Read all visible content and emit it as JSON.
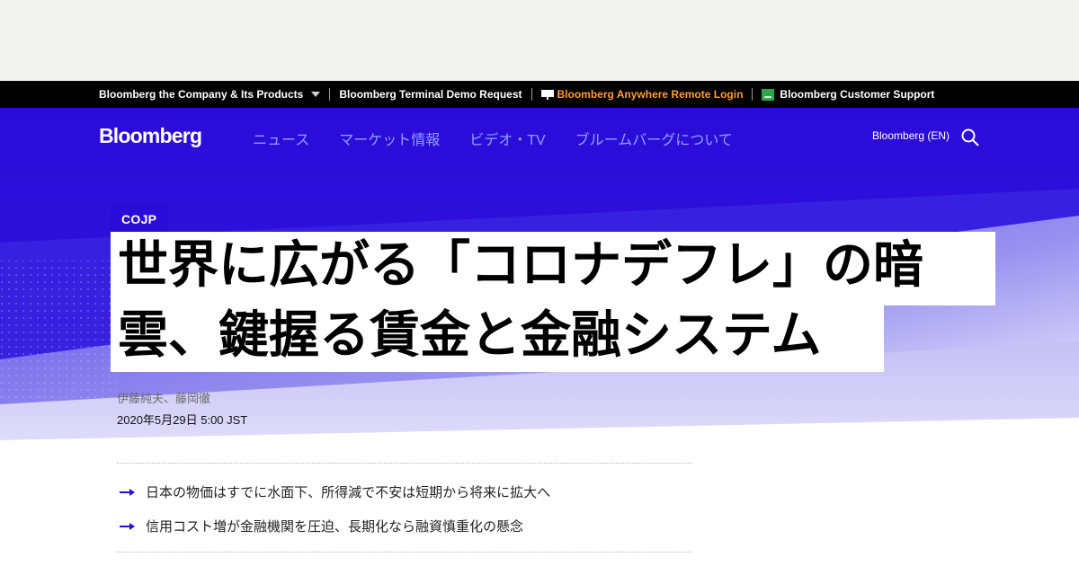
{
  "colors": {
    "accent_blue": "#2b0bd8",
    "util_orange": "#ff9c33",
    "nav_link": "#8fa0ff"
  },
  "utility_bar": {
    "items": [
      {
        "label": "Bloomberg the Company & Its Products",
        "icon": "caret-down-icon"
      },
      {
        "label": "Bloomberg Terminal Demo Request"
      },
      {
        "label": "Bloomberg Anywhere Remote Login",
        "icon": "monitor-icon"
      },
      {
        "label": "Bloomberg Customer Support",
        "icon": "help-icon"
      }
    ]
  },
  "header": {
    "logo": "Bloomberg",
    "nav": [
      "ニュース",
      "マーケット情報",
      "ビデオ・TV",
      "ブルームバーグについて"
    ],
    "edition_link": "Bloomberg (EN)",
    "search_icon": "search-icon"
  },
  "article": {
    "kicker": "COJP",
    "headline_line1": "世界に広がる「コロナデフレ」の暗",
    "headline_line2": "雲、鍵握る賃金と金融システム",
    "byline": "伊藤純夫、藤岡徹",
    "date": "2020年5月29日 5:00 JST",
    "abstract": [
      "日本の物価はすでに水面下、所得減で不安は短期から将来に拡大へ",
      "信用コスト増が金融機関を圧迫、長期化なら融資慎重化の懸念"
    ],
    "bullet_icon": "arrow-right-icon"
  }
}
